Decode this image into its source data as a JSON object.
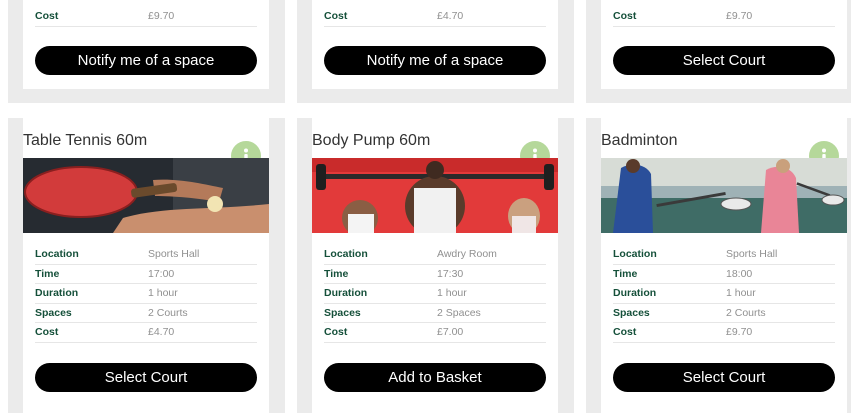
{
  "top_cards": [
    {
      "cost_label": "Cost",
      "cost": "£9.70",
      "button": "Notify me of a space"
    },
    {
      "cost_label": "Cost",
      "cost": "£4.70",
      "button": "Notify me of a space"
    },
    {
      "cost_label": "Cost",
      "cost": "£9.70",
      "button": "Select Court"
    }
  ],
  "cards": [
    {
      "title": "Table Tennis 60m",
      "image": "table-tennis-image",
      "labels": {
        "location": "Location",
        "time": "Time",
        "duration": "Duration",
        "spaces": "Spaces",
        "cost": "Cost"
      },
      "location": "Sports Hall",
      "time": "17:00",
      "duration": "1 hour",
      "spaces": "2 Courts",
      "cost": "£4.70",
      "button": "Select Court"
    },
    {
      "title": "Body Pump 60m",
      "image": "body-pump-image",
      "labels": {
        "location": "Location",
        "time": "Time",
        "duration": "Duration",
        "spaces": "Spaces",
        "cost": "Cost"
      },
      "location": "Awdry Room",
      "time": "17:30",
      "duration": "1 hour",
      "spaces": "2 Spaces",
      "cost": "£7.00",
      "button": "Add to Basket"
    },
    {
      "title": "Badminton",
      "image": "badminton-image",
      "labels": {
        "location": "Location",
        "time": "Time",
        "duration": "Duration",
        "spaces": "Spaces",
        "cost": "Cost"
      },
      "location": "Sports Hall",
      "time": "18:00",
      "duration": "1 hour",
      "spaces": "2 Courts",
      "cost": "£9.70",
      "button": "Select Court"
    }
  ],
  "colors": {
    "panel_bg": "#ebebeb",
    "label_green": "#15503a",
    "value_gray": "#909090",
    "button_bg": "#000000",
    "info_icon": "#b5d89a"
  },
  "icons": {
    "info": "info-icon"
  }
}
